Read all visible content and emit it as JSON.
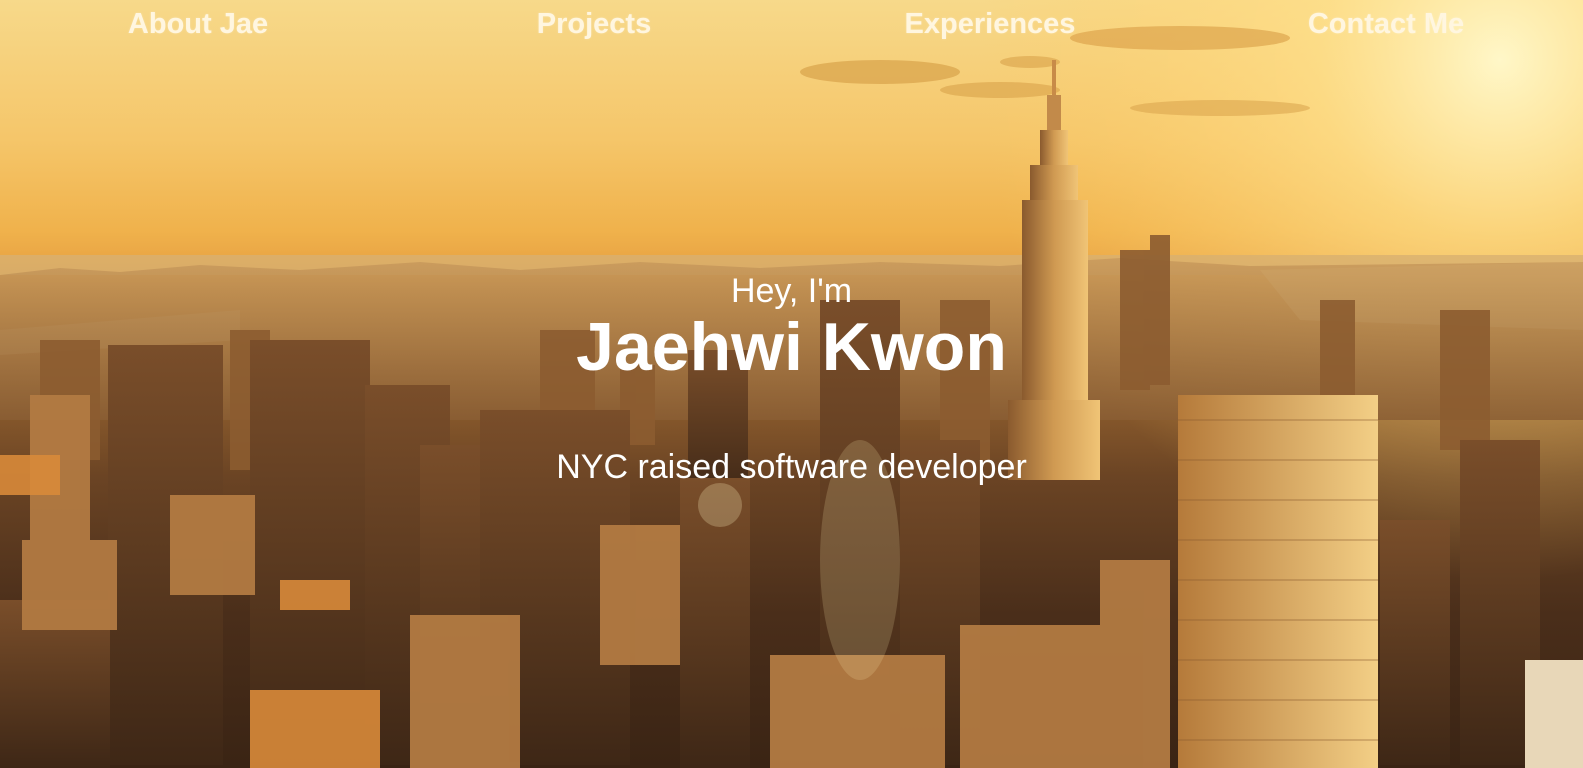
{
  "nav": {
    "items": [
      {
        "label": "About Jae"
      },
      {
        "label": "Projects"
      },
      {
        "label": "Experiences"
      },
      {
        "label": "Contact Me"
      }
    ]
  },
  "hero": {
    "greeting": "Hey, I'm",
    "name": "Jaehwi Kwon",
    "tagline": "NYC raised software developer",
    "background_image": "sunset-nyc-skyline-empire-state-building"
  },
  "colors": {
    "sky_top": "#f7d98a",
    "sun_glow": "#fff3b0",
    "skyline_dark": "#3a2414",
    "text": "#ffffff"
  }
}
